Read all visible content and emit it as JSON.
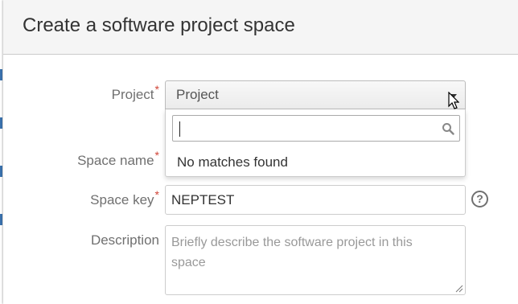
{
  "dialog": {
    "title": "Create a software project space"
  },
  "fields": {
    "project": {
      "label": "Project",
      "required_mark": "*",
      "selected_value": "Project",
      "search_value": "",
      "no_results_text": "No matches found"
    },
    "space_name": {
      "label": "Space name",
      "required_mark": "*"
    },
    "space_key": {
      "label": "Space key",
      "required_mark": "*",
      "value": "NEPTEST",
      "help_glyph": "?"
    },
    "description": {
      "label": "Description",
      "placeholder": "Briefly describe the software project in this space"
    }
  },
  "icons": {
    "dropdown_arrow": "chevron-down-icon",
    "search": "search-icon",
    "help": "help-icon",
    "cursor": "mouse-pointer-icon"
  },
  "colors": {
    "required": "#d04437",
    "label": "#707070",
    "header_bg": "#f5f5f5",
    "accent": "#3b73af"
  }
}
